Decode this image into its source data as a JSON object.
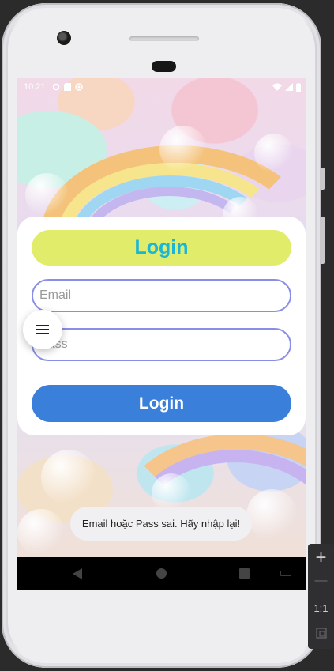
{
  "status_bar": {
    "time": "10:21"
  },
  "card": {
    "title": "Login",
    "email_placeholder": "Email",
    "password_placeholder": "Pass",
    "login_button_label": "Login"
  },
  "toast": {
    "message": "Email hoặc Pass sai. Hãy nhập lại!"
  },
  "emulator_toolbar": {
    "zoom_in": "+",
    "zoom_out": "—",
    "actual_size": "1:1"
  },
  "icons": {
    "fab": "menu-icon",
    "nav": [
      "back-icon",
      "home-icon",
      "recents-icon",
      "keyboard-icon"
    ]
  },
  "colors": {
    "title_pill": "#e1ec6b",
    "title_text": "#19b6d9",
    "field_border": "#8a8fe6",
    "login_button": "#3a7fd9"
  }
}
